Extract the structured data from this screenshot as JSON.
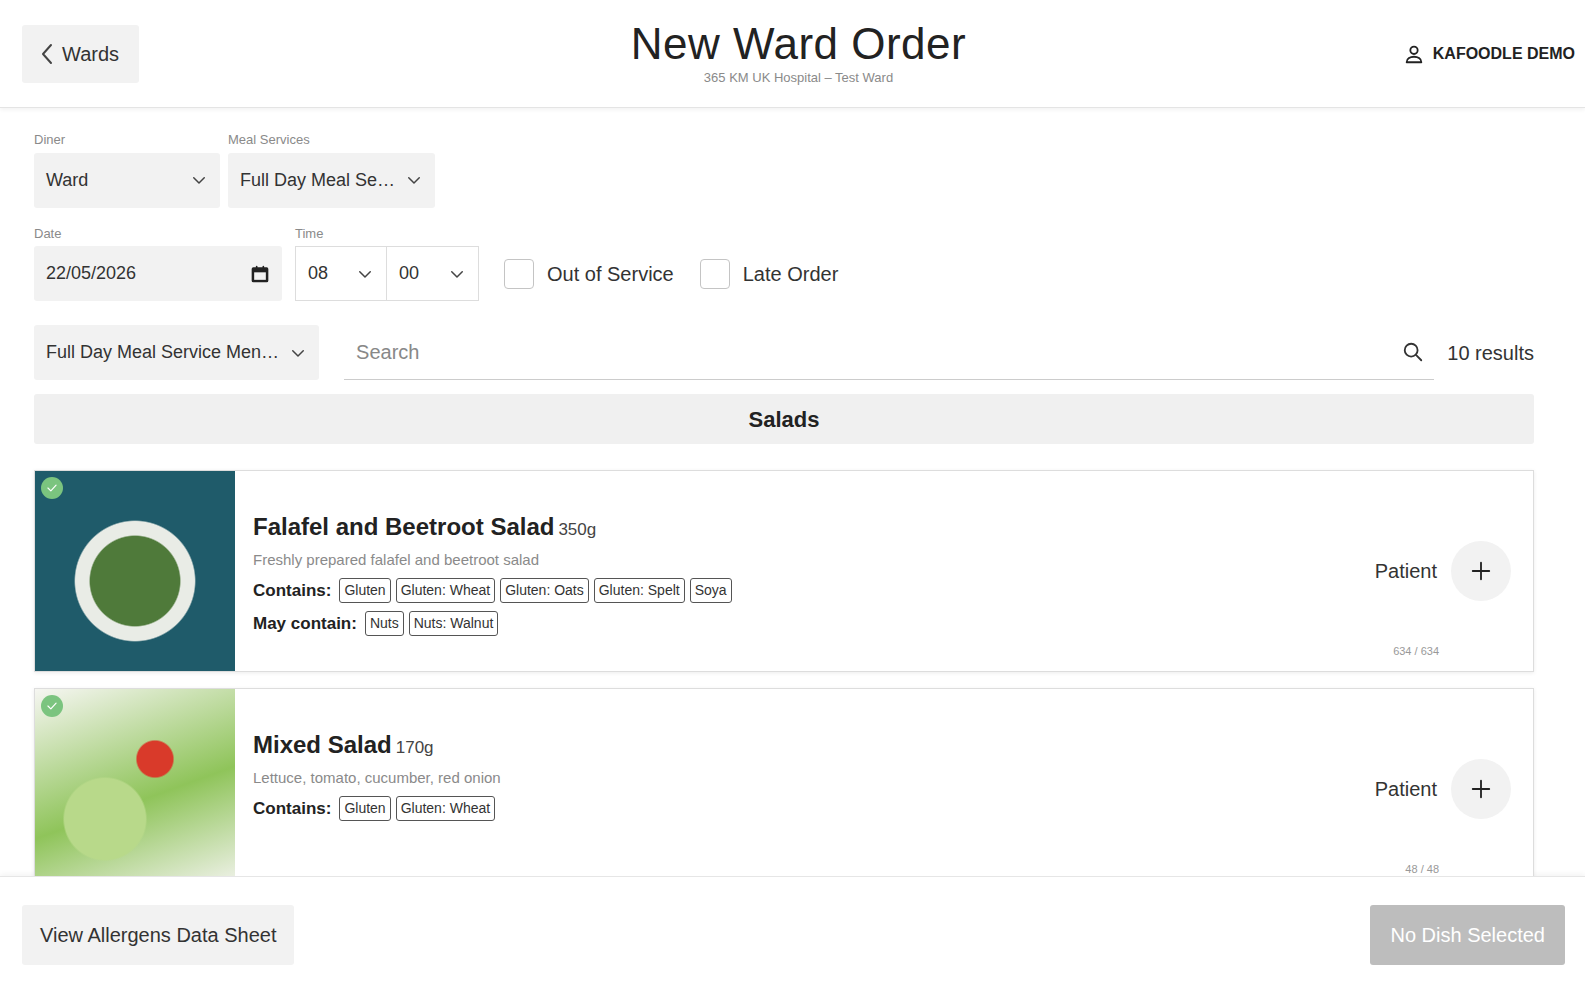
{
  "header": {
    "back": "Wards",
    "title": "New Ward Order",
    "subtitle": "365 KM UK Hospital – Test Ward",
    "user": "KAFOODLE DEMO"
  },
  "filters": {
    "diner": {
      "label": "Diner",
      "value": "Ward"
    },
    "meal_services": {
      "label": "Meal Services",
      "value": "Full Day Meal Se…"
    },
    "date": {
      "label": "Date",
      "value": "22/05/2026"
    },
    "time": {
      "label": "Time",
      "hour": "08",
      "minute": "00"
    },
    "checkboxes": [
      {
        "label": "Out of Service",
        "checked": false
      },
      {
        "label": "Late Order",
        "checked": false
      }
    ],
    "menu": "Full Day Meal Service Men…",
    "search": {
      "placeholder": "Search"
    },
    "results": "10 results"
  },
  "section": "Salads",
  "dishes": [
    {
      "name": "Falafel and Beetroot Salad",
      "weight": "350g",
      "description": "Freshly prepared falafel and beetroot salad",
      "available": true,
      "allergens": [
        {
          "label": "Contains:",
          "tags": [
            "Gluten",
            "Gluten: Wheat",
            "Gluten: Oats",
            "Gluten: Spelt",
            "Soya"
          ]
        },
        {
          "label": "May contain:",
          "tags": [
            "Nuts",
            "Nuts: Walnut"
          ]
        }
      ],
      "diner": "Patient",
      "stock": "634 / 634"
    },
    {
      "name": "Mixed Salad",
      "weight": "170g",
      "description": "Lettuce, tomato, cucumber, red onion",
      "available": true,
      "allergens": [
        {
          "label": "Contains:",
          "tags": [
            "Gluten",
            "Gluten: Wheat"
          ]
        }
      ],
      "diner": "Patient",
      "stock": "48 / 48"
    }
  ],
  "footer": {
    "allergens_button": "View Allergens Data Sheet",
    "submit": {
      "label": "No Dish Selected",
      "disabled": true
    }
  }
}
